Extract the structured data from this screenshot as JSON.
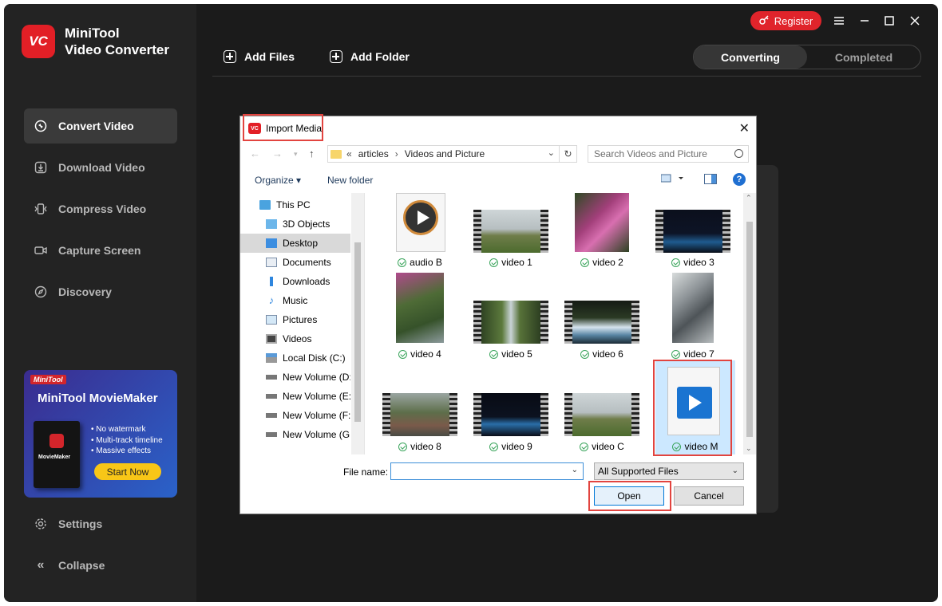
{
  "app": {
    "name_line1": "MiniTool",
    "name_line2": "Video Converter",
    "logo_text": "VC",
    "register_label": "Register",
    "window_controls": [
      "menu-icon",
      "minimize-icon",
      "maximize-icon",
      "close-icon"
    ]
  },
  "sidebar": {
    "items": [
      {
        "label": "Convert Video",
        "icon": "convert-icon",
        "active": true
      },
      {
        "label": "Download Video",
        "icon": "download-icon",
        "active": false
      },
      {
        "label": "Compress Video",
        "icon": "compress-icon",
        "active": false
      },
      {
        "label": "Capture Screen",
        "icon": "camera-icon",
        "active": false
      },
      {
        "label": "Discovery",
        "icon": "compass-icon",
        "active": false
      }
    ],
    "promo": {
      "badge": "MiniTool",
      "title": "MiniTool MovieMaker",
      "box_label": "MovieMaker",
      "features": [
        "• No watermark",
        "• Multi-track timeline",
        "• Massive effects"
      ],
      "cta": "Start Now"
    },
    "settings_label": "Settings",
    "collapse_label": "Collapse"
  },
  "toolbar": {
    "add_files_label": "Add Files",
    "add_folder_label": "Add Folder",
    "tabs": [
      {
        "label": "Converting",
        "active": true
      },
      {
        "label": "Completed",
        "active": false
      }
    ]
  },
  "dialog": {
    "title": "Import Media",
    "breadcrumb": {
      "prefix": "«",
      "parts": [
        "articles",
        "Videos and Picture"
      ]
    },
    "search_placeholder": "Search Videos and Picture",
    "organize_label": "Organize ▾",
    "new_folder_label": "New folder",
    "tree": [
      {
        "label": "This PC",
        "icon": "pc-icon",
        "selected": false
      },
      {
        "label": "3D Objects",
        "icon": "cube-icon",
        "selected": false
      },
      {
        "label": "Desktop",
        "icon": "desktop-icon",
        "selected": true
      },
      {
        "label": "Documents",
        "icon": "documents-icon",
        "selected": false
      },
      {
        "label": "Downloads",
        "icon": "downloads-icon",
        "selected": false
      },
      {
        "label": "Music",
        "icon": "music-icon",
        "selected": false
      },
      {
        "label": "Pictures",
        "icon": "pictures-icon",
        "selected": false
      },
      {
        "label": "Videos",
        "icon": "videos-icon",
        "selected": false
      },
      {
        "label": "Local Disk (C:)",
        "icon": "disk-icon",
        "selected": false
      },
      {
        "label": "New Volume (D:",
        "icon": "drive-icon",
        "selected": false
      },
      {
        "label": "New Volume (E:)",
        "icon": "drive-icon",
        "selected": false
      },
      {
        "label": "New Volume (F:)",
        "icon": "drive-icon",
        "selected": false
      },
      {
        "label": "New Volume (G:",
        "icon": "drive-icon",
        "selected": false
      }
    ],
    "files": [
      {
        "name": "audio B",
        "kind": "audio"
      },
      {
        "name": "video 1",
        "kind": "film"
      },
      {
        "name": "video 2",
        "kind": "portrait"
      },
      {
        "name": "video 3",
        "kind": "film"
      },
      {
        "name": "video 4",
        "kind": "portrait"
      },
      {
        "name": "video 5",
        "kind": "film"
      },
      {
        "name": "video 6",
        "kind": "film"
      },
      {
        "name": "video 7",
        "kind": "portrait"
      },
      {
        "name": "video 8",
        "kind": "film"
      },
      {
        "name": "video 9",
        "kind": "film"
      },
      {
        "name": "video C",
        "kind": "film"
      },
      {
        "name": "video M",
        "kind": "icon",
        "selected": true
      }
    ],
    "file_name_label": "File name:",
    "file_name_value": "",
    "filter_label": "All Supported Files",
    "open_label": "Open",
    "cancel_label": "Cancel"
  }
}
